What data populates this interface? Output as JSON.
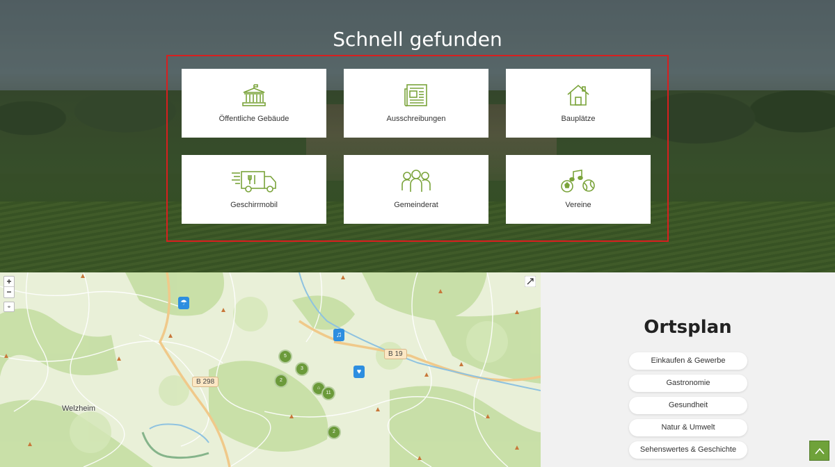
{
  "hero": {
    "title": "Schnell gefunden",
    "tiles": [
      {
        "label": "Öffentliche Gebäude",
        "icon": "building-icon"
      },
      {
        "label": "Ausschreibungen",
        "icon": "newspaper-icon"
      },
      {
        "label": "Bauplätze",
        "icon": "house-icon"
      },
      {
        "label": "Geschirrmobil",
        "icon": "truck-icon"
      },
      {
        "label": "Gemeinderat",
        "icon": "people-icon"
      },
      {
        "label": "Vereine",
        "icon": "music-sports-icon"
      }
    ],
    "accent_color": "#7aa33a",
    "highlight_color": "#d81f1f"
  },
  "map": {
    "zoom_in": "+",
    "zoom_out": "−",
    "locate": "⌖",
    "roads": [
      "B 19",
      "B 298"
    ],
    "places": [
      "Welzheim"
    ],
    "clusters": [
      "5",
      "3",
      "2",
      "11",
      "2"
    ],
    "cluster_icon_value": "",
    "cluster_color": "#6b9a3a",
    "pin_color": "#2d8ee0"
  },
  "ortsplan": {
    "title": "Ortsplan",
    "categories": [
      "Einkaufen & Gewerbe",
      "Gastronomie",
      "Gesundheit",
      "Natur & Umwelt",
      "Sehenswertes & Geschichte"
    ]
  },
  "scroll_top": {
    "color": "#6fa23a"
  }
}
